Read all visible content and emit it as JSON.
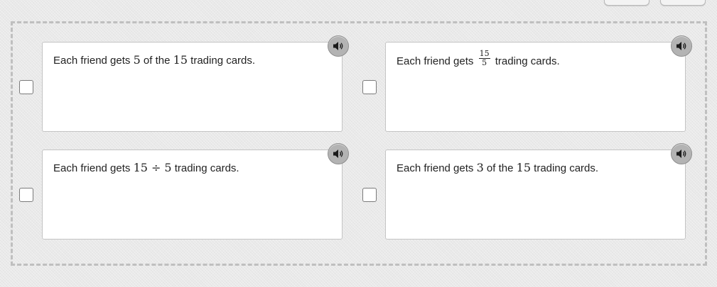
{
  "choices": [
    {
      "prefix": "Each friend gets ",
      "math_1": "5",
      "middle": " of the ",
      "math_2": "15",
      "suffix": " trading cards.",
      "audio_icon": "speaker-icon"
    },
    {
      "prefix": "Each friend gets ",
      "frac_num": "15",
      "frac_den": "5",
      "suffix": " trading cards.",
      "audio_icon": "speaker-icon"
    },
    {
      "prefix": "Each friend gets ",
      "math_1": "15",
      "operator": "÷",
      "math_2": "5",
      "suffix": " trading cards.",
      "audio_icon": "speaker-icon"
    },
    {
      "prefix": "Each friend gets ",
      "math_1": "3",
      "middle": " of the ",
      "math_2": "15",
      "suffix": " trading cards.",
      "audio_icon": "speaker-icon"
    }
  ],
  "colors": {
    "background": "#e9e9e9",
    "card_border": "#c4c4c4",
    "audio_button": "#b3b3b3",
    "dashed_border": "#bfbfbf",
    "text": "#222222"
  }
}
